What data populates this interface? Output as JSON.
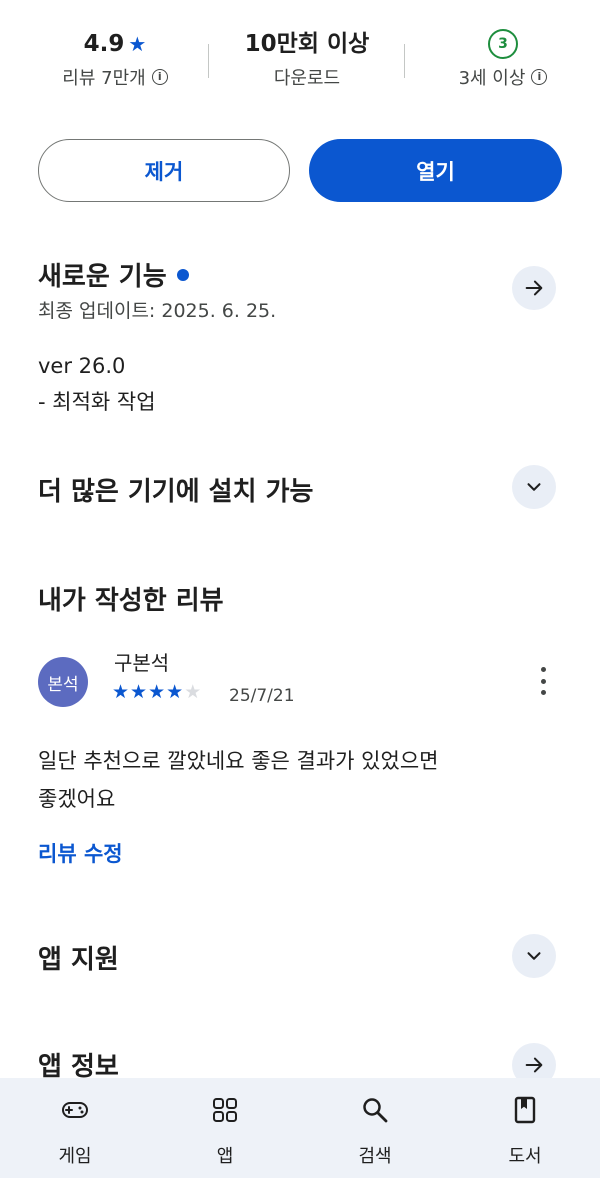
{
  "stats": {
    "rating": {
      "value": "4.9",
      "star": "★",
      "label": "리뷰 7만개",
      "info": "i"
    },
    "downloads": {
      "value": "10만회 이상",
      "label": "다운로드"
    },
    "age": {
      "badge": "3",
      "label": "3세 이상",
      "info": "i"
    }
  },
  "actions": {
    "remove_label": "제거",
    "open_label": "열기"
  },
  "whats_new": {
    "title": "새로운 기능",
    "updated": "최종 업데이트: 2025. 6. 25.",
    "version": "ver 26.0",
    "notes": "- 최적화 작업"
  },
  "devices": {
    "title": "더 많은 기기에 설치 가능"
  },
  "my_review": {
    "title": "내가 작성한 리뷰",
    "avatar_text": "본석",
    "reviewer": "구본석",
    "rating": 4,
    "max_rating": 5,
    "date": "25/7/21",
    "text_line1": "일단 추천으로 깔았네요 좋은 결과가 있었으면",
    "text_line2": "좋겠어요",
    "edit_label": "리뷰 수정"
  },
  "support": {
    "title": "앱 지원"
  },
  "app_info": {
    "title": "앱 정보"
  },
  "nav": [
    {
      "label": "게임",
      "icon": "gamepad-icon"
    },
    {
      "label": "앱",
      "icon": "apps-grid-icon"
    },
    {
      "label": "검색",
      "icon": "search-icon"
    },
    {
      "label": "도서",
      "icon": "book-icon"
    }
  ],
  "colors": {
    "accent": "#0b57d0",
    "age_badge": "#1e8e3e",
    "avatar_bg": "#5c6bc0",
    "nav_bg": "#eef2f8"
  }
}
